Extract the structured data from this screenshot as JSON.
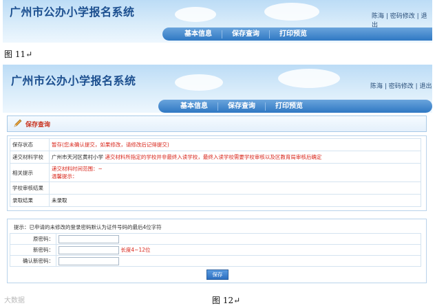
{
  "header_top": {
    "title": "广州市公办小学报名系统",
    "links": "陈海 | 密码修改 | 退出",
    "nav": [
      "基本信息",
      "保存查询",
      "打印预览"
    ]
  },
  "caption_top": "图 11↵",
  "header_main": {
    "title": "广州市公办小学报名系统",
    "links": "陈海 | 密码修改 | 退出",
    "nav": [
      "基本信息",
      "保存查询",
      "打印预览"
    ]
  },
  "panel": {
    "title": "保存查询"
  },
  "info_rows": [
    {
      "label": "保存状态",
      "value": "暂存(您未确认提交，如果修改，请修改后记得提交)"
    },
    {
      "label": "递交材料学校",
      "value_plain": "广州市天河区黄村小学",
      "value_red": "递交材料所指定的学校并非最终入读学校，最终入读学校需要学校审核以及区教育局审核后确定"
    },
    {
      "label": "相关提示",
      "line1": "递交材料时间范围：~",
      "line2": "温馨提示："
    },
    {
      "label": "学校审核结果",
      "value": ""
    },
    {
      "label": "录取结果",
      "value": "未录取"
    }
  ],
  "password": {
    "hint": "提示：已申请的未修改的登录密码默认为证件号码的最后4位字符",
    "old_label": "原密码：",
    "new_label": "新密码：",
    "new_note": "长度4~12位",
    "confirm_label": "确认新密码：",
    "save_label": "保存"
  },
  "caption_bottom": "图 12↵",
  "watermark": "大数据"
}
